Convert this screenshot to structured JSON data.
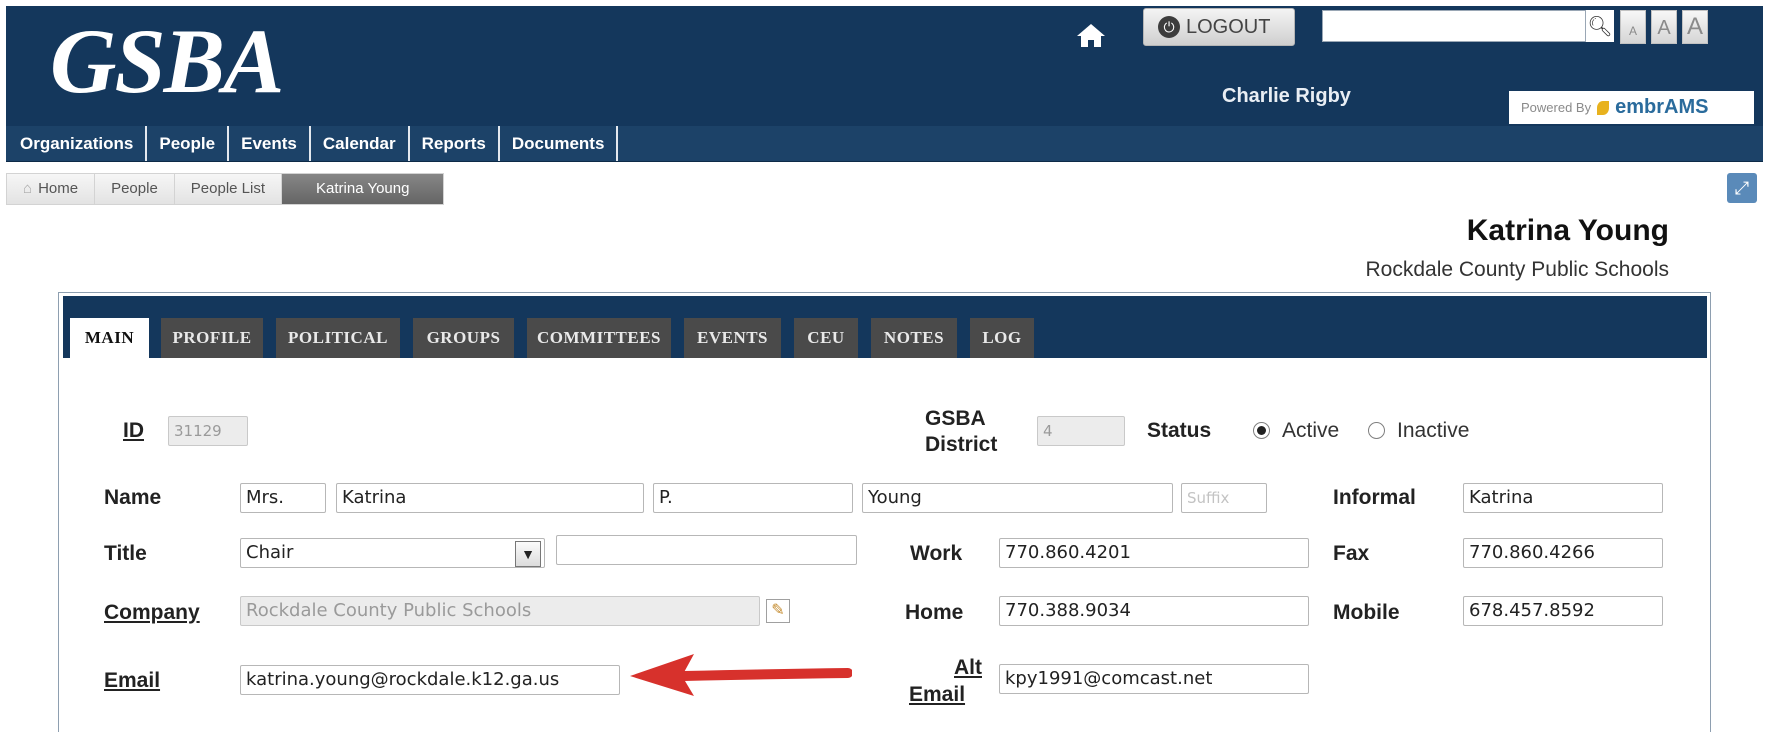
{
  "header": {
    "logo_text": "GSBA",
    "logout_label": "LOGOUT",
    "search_placeholder": "",
    "font_size_buttons": [
      "A",
      "A",
      "A"
    ],
    "user_name": "Charlie Rigby",
    "powered_by": "Powered By",
    "powered_brand": "embrAMS"
  },
  "nav": {
    "items": [
      {
        "label": "Organizations"
      },
      {
        "label": "People"
      },
      {
        "label": "Events"
      },
      {
        "label": "Calendar"
      },
      {
        "label": "Reports"
      },
      {
        "label": "Documents"
      }
    ]
  },
  "breadcrumb": {
    "items": [
      {
        "label": "Home"
      },
      {
        "label": "People"
      },
      {
        "label": "People List"
      },
      {
        "label": "Katrina Young"
      }
    ]
  },
  "person": {
    "name": "Katrina Young",
    "organization": "Rockdale County Public Schools"
  },
  "tabs": [
    {
      "label": "MAIN",
      "active": true
    },
    {
      "label": "PROFILE"
    },
    {
      "label": "POLITICAL"
    },
    {
      "label": "GROUPS"
    },
    {
      "label": "COMMITTEES"
    },
    {
      "label": "EVENTS"
    },
    {
      "label": "CEU"
    },
    {
      "label": "NOTES"
    },
    {
      "label": "LOG"
    }
  ],
  "form": {
    "id_label": "ID",
    "id_value": "31129",
    "district_label_1": "GSBA",
    "district_label_2": "District",
    "district_value": "4",
    "status_label": "Status",
    "status_options": [
      "Active",
      "Inactive"
    ],
    "status_selected": "Active",
    "name_label": "Name",
    "name_prefix": "Mrs.",
    "name_first": "Katrina",
    "name_middle": "P.",
    "name_last": "Young",
    "name_suffix_placeholder": "Suffix",
    "informal_label": "Informal",
    "informal_value": "Katrina",
    "title_label": "Title",
    "title_select_value": "Chair",
    "title_text_value": "",
    "work_label": "Work",
    "work_value": "770.860.4201",
    "fax_label": "Fax",
    "fax_value": "770.860.4266",
    "company_label": "Company",
    "company_value": "Rockdale County Public Schools",
    "home_label": "Home",
    "home_value": "770.388.9034",
    "mobile_label": "Mobile",
    "mobile_value": "678.457.8592",
    "email_label": "Email",
    "email_value": "katrina.young@rockdale.k12.ga.us",
    "alt_email_label_1": "Alt",
    "alt_email_label_2": "Email",
    "alt_email_value": "kpy1991@comcast.net"
  },
  "colors": {
    "header_bg": "#14375c",
    "nav_bg": "#1c4268",
    "tab_bg": "#4a4a4a",
    "annotation_arrow": "#d7312c"
  }
}
